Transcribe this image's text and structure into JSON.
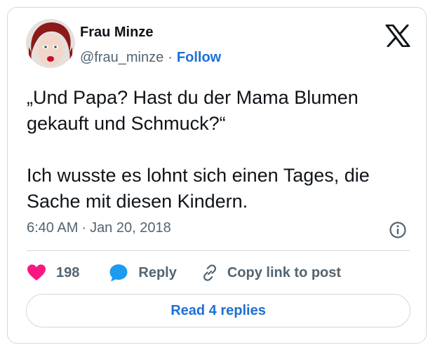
{
  "author": {
    "name": "Frau Minze",
    "handle": "@frau_minze",
    "separator": "·",
    "follow_label": "Follow"
  },
  "tweet": {
    "paragraphs": [
      [
        "„Und Papa? Hast du der Mama Blumen",
        "gekauft und Schmuck?“"
      ],
      [
        "Ich wusste es lohnt sich einen Tages, die",
        "Sache mit diesen Kindern."
      ]
    ],
    "time": "6:40 AM",
    "separator": "·",
    "date": "Jan 20, 2018"
  },
  "actions": {
    "like_count": "198",
    "reply_label": "Reply",
    "copy_link_label": "Copy link to post"
  },
  "read_replies_label": "Read 4 replies",
  "icons": {
    "brand": "x-logo-icon",
    "info": "info-icon",
    "like": "heart-icon",
    "reply": "speech-bubble-icon",
    "copy": "link-icon"
  },
  "colors": {
    "link": "#1d6fd8",
    "like": "#f91880",
    "reply": "#1d9bf0",
    "secondary_text": "#536471",
    "border": "#cfd9de"
  }
}
